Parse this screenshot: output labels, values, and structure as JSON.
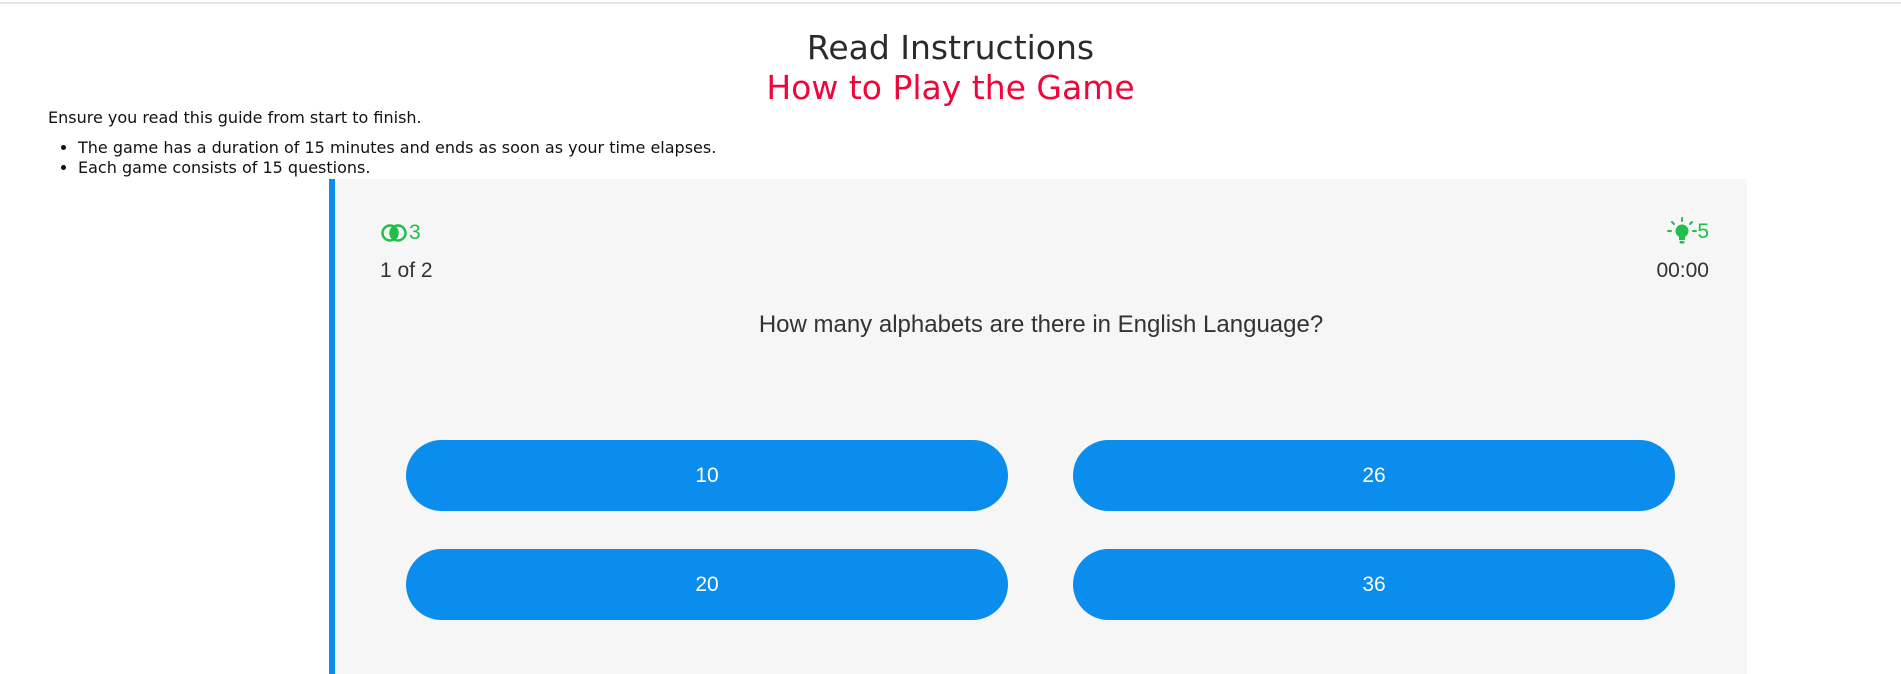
{
  "header": {
    "title": "Read Instructions",
    "subtitle": "How to Play the Game"
  },
  "instructions": {
    "intro": "Ensure you read this guide from start to finish.",
    "rules": [
      "The game has a duration of 15 minutes and ends as soon as your time elapses.",
      "Each game consists of 15 questions."
    ]
  },
  "quiz": {
    "lifeline_icon": "fifty-fifty-icon",
    "lifeline_count": "3",
    "hint_icon": "lightbulb-icon",
    "hint_count": "5",
    "counter": "1 of 2",
    "timer": "00:00",
    "question": "How many alphabets are there in English Language?",
    "options": [
      "10",
      "26",
      "20",
      "36"
    ]
  },
  "colors": {
    "accent": "#0a8ded",
    "subtitle": "#f0073a",
    "status_green": "#1fbf4a",
    "card_background": "#f6f6f6"
  }
}
